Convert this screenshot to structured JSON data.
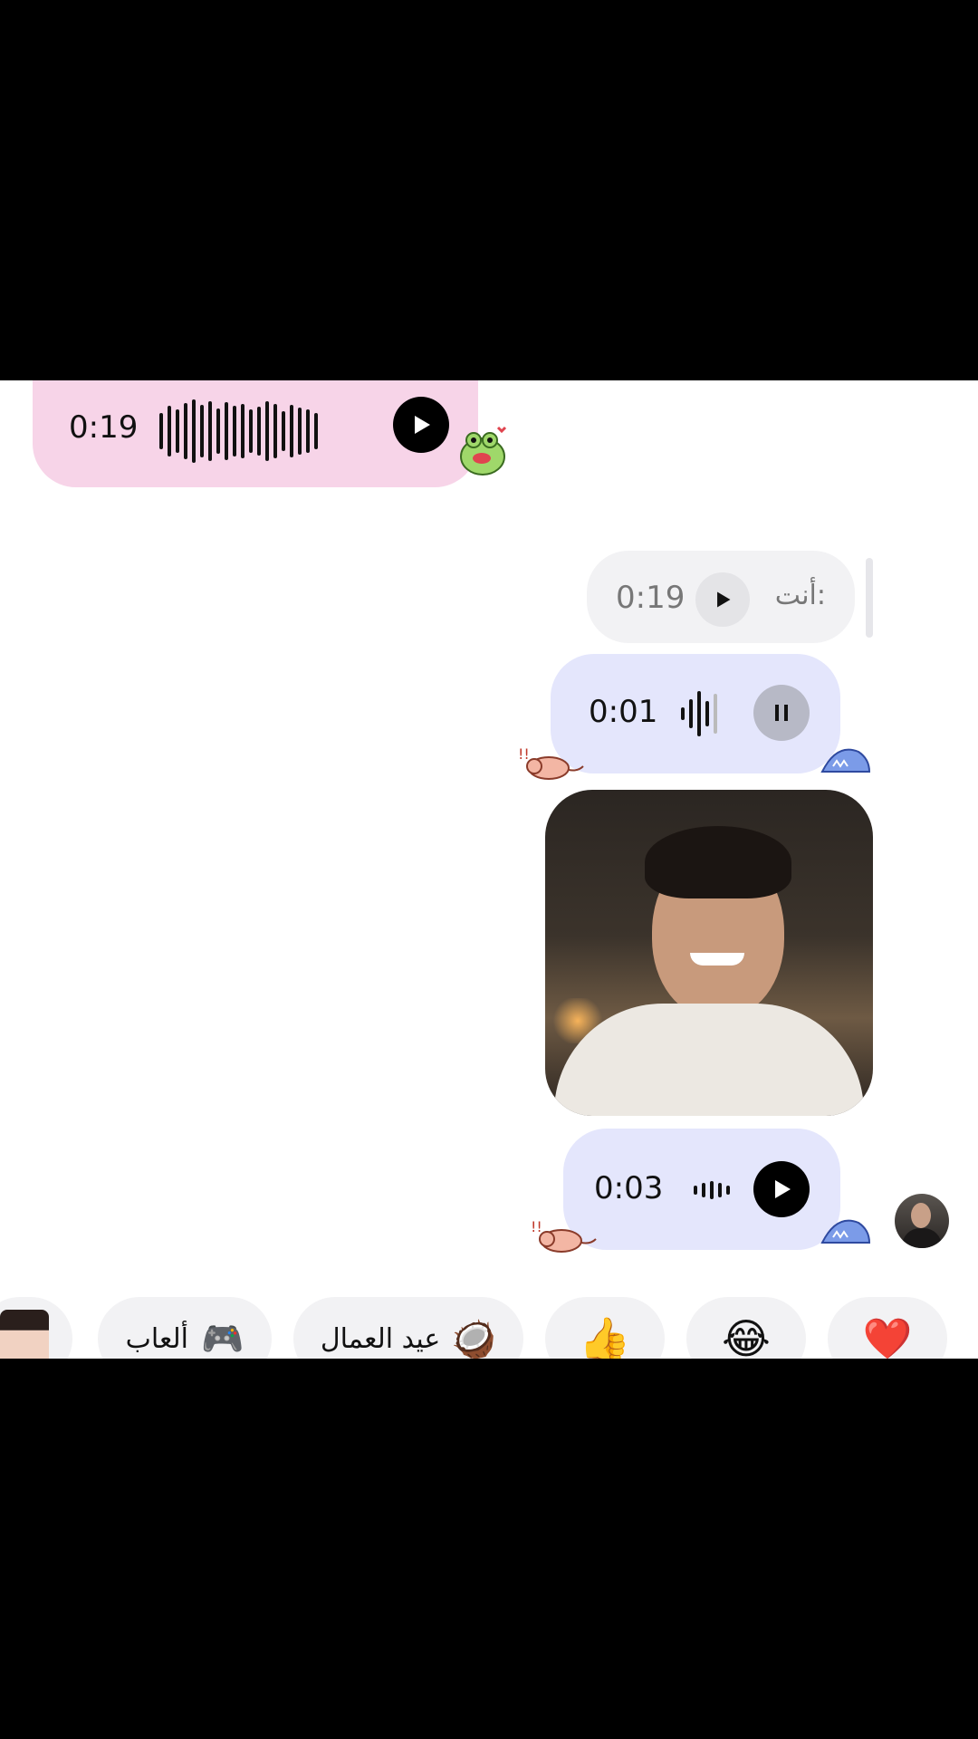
{
  "messages": {
    "voice_1": {
      "duration": "0:19",
      "state": "play"
    },
    "reply_preview": {
      "prefix": "أنت:",
      "duration": "0:19"
    },
    "voice_2": {
      "duration": "0:01",
      "state": "pause"
    },
    "video": {
      "type": "video-note"
    },
    "voice_3": {
      "duration": "0:03",
      "state": "play"
    }
  },
  "quick_replies": {
    "heart": "❤️",
    "laugh": "😂",
    "thumbs": "👍",
    "labor_day_label": "عيد العمال",
    "labor_day_emoji": "🥥",
    "games_label": "ألعاب",
    "games_emoji": "🎮"
  },
  "colors": {
    "pink_bubble": "#f7d4e8",
    "blue_bubble": "#e4e6fc",
    "gray_bubble": "#f2f2f4"
  }
}
